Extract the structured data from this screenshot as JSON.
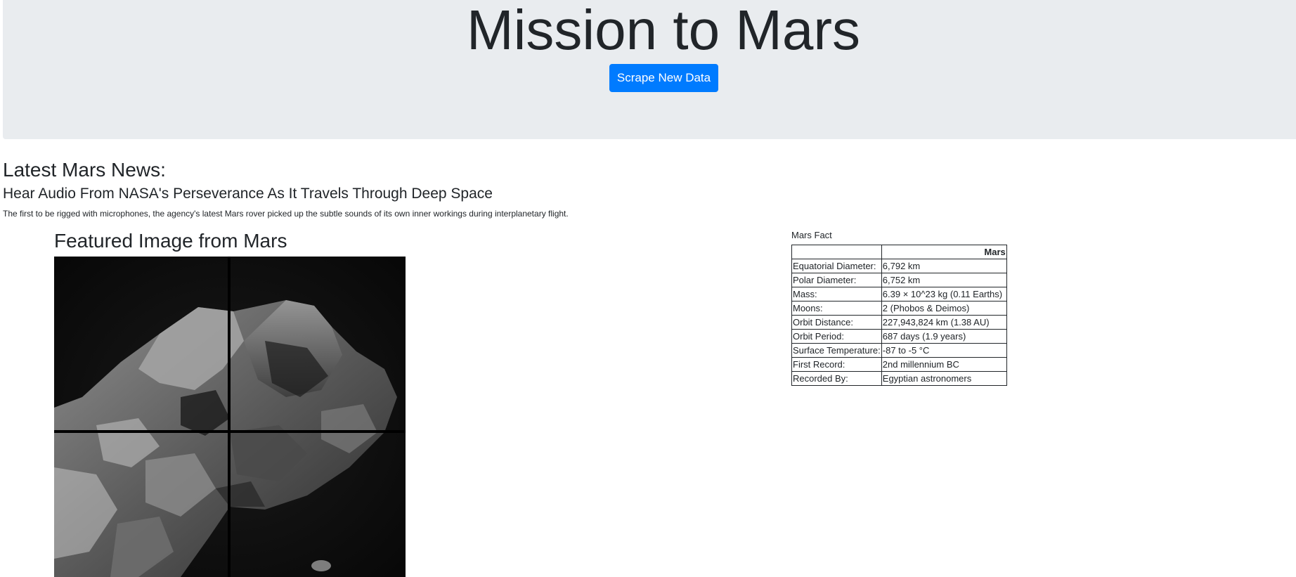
{
  "header": {
    "title": "Mission to Mars",
    "scrape_button_label": "Scrape New Data"
  },
  "news": {
    "heading": "Latest Mars News:",
    "title": "Hear Audio From NASA's Perseverance As It Travels Through Deep Space",
    "teaser": "The first to be rigged with microphones, the agency's latest Mars rover picked up the subtle sounds of its own inner workings during interplanetary flight."
  },
  "featured": {
    "heading": "Featured Image from Mars"
  },
  "facts": {
    "caption": "Mars Fact",
    "column_header": "Mars",
    "rows": [
      {
        "label": "Equatorial Diameter:",
        "value": "6,792 km"
      },
      {
        "label": "Polar Diameter:",
        "value": "6,752 km"
      },
      {
        "label": "Mass:",
        "value": "6.39 × 10^23 kg (0.11 Earths)"
      },
      {
        "label": "Moons:",
        "value": "2 (Phobos & Deimos)"
      },
      {
        "label": "Orbit Distance:",
        "value": "227,943,824 km (1.38 AU)"
      },
      {
        "label": "Orbit Period:",
        "value": "687 days (1.9 years)"
      },
      {
        "label": "Surface Temperature:",
        "value": "-87 to -5 °C"
      },
      {
        "label": "First Record:",
        "value": "2nd millennium BC"
      },
      {
        "label": "Recorded By:",
        "value": "Egyptian astronomers"
      }
    ]
  }
}
